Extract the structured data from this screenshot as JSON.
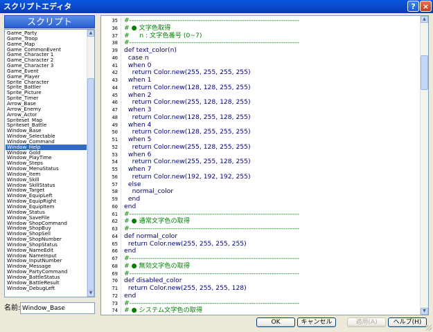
{
  "window": {
    "title": "スクリプトエディタ",
    "help_glyph": "?",
    "close_glyph": "×"
  },
  "left_panel": {
    "header": "スクリプト",
    "selected_index": 21,
    "scripts": [
      "Game_Party",
      "Game_Troop",
      "Game_Map",
      "Game_CommonEvent",
      "Game_Character 1",
      "Game_Character 2",
      "Game_Character 3",
      "Game_Event",
      "Game_Player",
      "Sprite_Character",
      "Sprite_Battler",
      "Sprite_Picture",
      "Sprite_Timer",
      "Arrow_Base",
      "Arrow_Enemy",
      "Arrow_Actor",
      "Spriteset_Map",
      "Spriteset_Battle",
      "Window_Base",
      "Window_Selectable",
      "Window_Command",
      "Window_Help",
      "Window_Gold",
      "Window_PlayTime",
      "Window_Steps",
      "Window_MenuStatus",
      "Window_Item",
      "Window_Skill",
      "Window_SkillStatus",
      "Window_Target",
      "Window_EquipLeft",
      "Window_EquipRight",
      "Window_EquipItem",
      "Window_Status",
      "Window_SaveFile",
      "Window_ShopCommand",
      "Window_ShopBuy",
      "Window_ShopSell",
      "Window_ShopNumber",
      "Window_ShopStatus",
      "Window_NameEdit",
      "Window_NameInput",
      "Window_InputNumber",
      "Window_Message",
      "Window_PartyCommand",
      "Window_BattleStatus",
      "Window_BattleResult",
      "Window_DebugLeft"
    ],
    "name_label": "名前:",
    "name_value": "Window_Base"
  },
  "editor": {
    "lines": [
      {
        "n": "35",
        "t": "#--------------------------------------------------------------------------",
        "k": "comment"
      },
      {
        "n": "36",
        "t": "# ● 文字色取得",
        "k": "comment"
      },
      {
        "n": "37",
        "t": "#     n : 文字色番号 (0~7)",
        "k": "comment"
      },
      {
        "n": "38",
        "t": "#--------------------------------------------------------------------------",
        "k": "comment"
      },
      {
        "n": "39",
        "t": "def text_color(n)",
        "k": "normal"
      },
      {
        "n": "40",
        "t": "  case n",
        "k": "normal"
      },
      {
        "n": "41",
        "t": "  when 0",
        "k": "normal"
      },
      {
        "n": "42",
        "t": "    return Color.new(255, 255, 255, 255)",
        "k": "normal"
      },
      {
        "n": "43",
        "t": "  when 1",
        "k": "normal"
      },
      {
        "n": "44",
        "t": "    return Color.new(128, 128, 255, 255)",
        "k": "normal"
      },
      {
        "n": "45",
        "t": "  when 2",
        "k": "normal"
      },
      {
        "n": "46",
        "t": "    return Color.new(255, 128, 128, 255)",
        "k": "normal"
      },
      {
        "n": "47",
        "t": "  when 3",
        "k": "normal"
      },
      {
        "n": "48",
        "t": "    return Color.new(128, 255, 128, 255)",
        "k": "normal"
      },
      {
        "n": "49",
        "t": "  when 4",
        "k": "normal"
      },
      {
        "n": "50",
        "t": "    return Color.new(128, 255, 255, 255)",
        "k": "normal"
      },
      {
        "n": "51",
        "t": "  when 5",
        "k": "normal"
      },
      {
        "n": "52",
        "t": "    return Color.new(255, 128, 255, 255)",
        "k": "normal"
      },
      {
        "n": "53",
        "t": "  when 6",
        "k": "normal"
      },
      {
        "n": "54",
        "t": "    return Color.new(255, 255, 128, 255)",
        "k": "normal"
      },
      {
        "n": "55",
        "t": "  when 7",
        "k": "normal"
      },
      {
        "n": "56",
        "t": "    return Color.new(192, 192, 192, 255)",
        "k": "normal"
      },
      {
        "n": "57",
        "t": "  else",
        "k": "normal"
      },
      {
        "n": "58",
        "t": "    normal_color",
        "k": "normal"
      },
      {
        "n": "59",
        "t": "  end",
        "k": "normal"
      },
      {
        "n": "60",
        "t": "end",
        "k": "normal"
      },
      {
        "n": "61",
        "t": "#--------------------------------------------------------------------------",
        "k": "comment"
      },
      {
        "n": "62",
        "t": "# ● 通常文字色の取得",
        "k": "comment"
      },
      {
        "n": "63",
        "t": "#--------------------------------------------------------------------------",
        "k": "comment"
      },
      {
        "n": "64",
        "t": "def normal_color",
        "k": "normal"
      },
      {
        "n": "65",
        "t": "  return Color.new(255, 255, 255, 255)",
        "k": "normal"
      },
      {
        "n": "66",
        "t": "end",
        "k": "normal"
      },
      {
        "n": "67",
        "t": "#--------------------------------------------------------------------------",
        "k": "comment"
      },
      {
        "n": "68",
        "t": "# ● 無効文字色の取得",
        "k": "comment"
      },
      {
        "n": "69",
        "t": "#--------------------------------------------------------------------------",
        "k": "comment"
      },
      {
        "n": "70",
        "t": "def disabled_color",
        "k": "normal"
      },
      {
        "n": "71",
        "t": "  return Color.new(255, 255, 255, 128)",
        "k": "normal"
      },
      {
        "n": "72",
        "t": "end",
        "k": "normal"
      },
      {
        "n": "73",
        "t": "#--------------------------------------------------------------------------",
        "k": "comment"
      },
      {
        "n": "74",
        "t": "# ● システム文字色の取得",
        "k": "comment"
      }
    ]
  },
  "buttons": {
    "ok": "OK",
    "cancel": "キャンセル",
    "apply": "適用(A)",
    "help": "ヘルプ(H)"
  },
  "colors": {
    "title_bar": "#0b46c8",
    "selection": "#316ac5",
    "comment": "#008000",
    "code": "#000080"
  }
}
